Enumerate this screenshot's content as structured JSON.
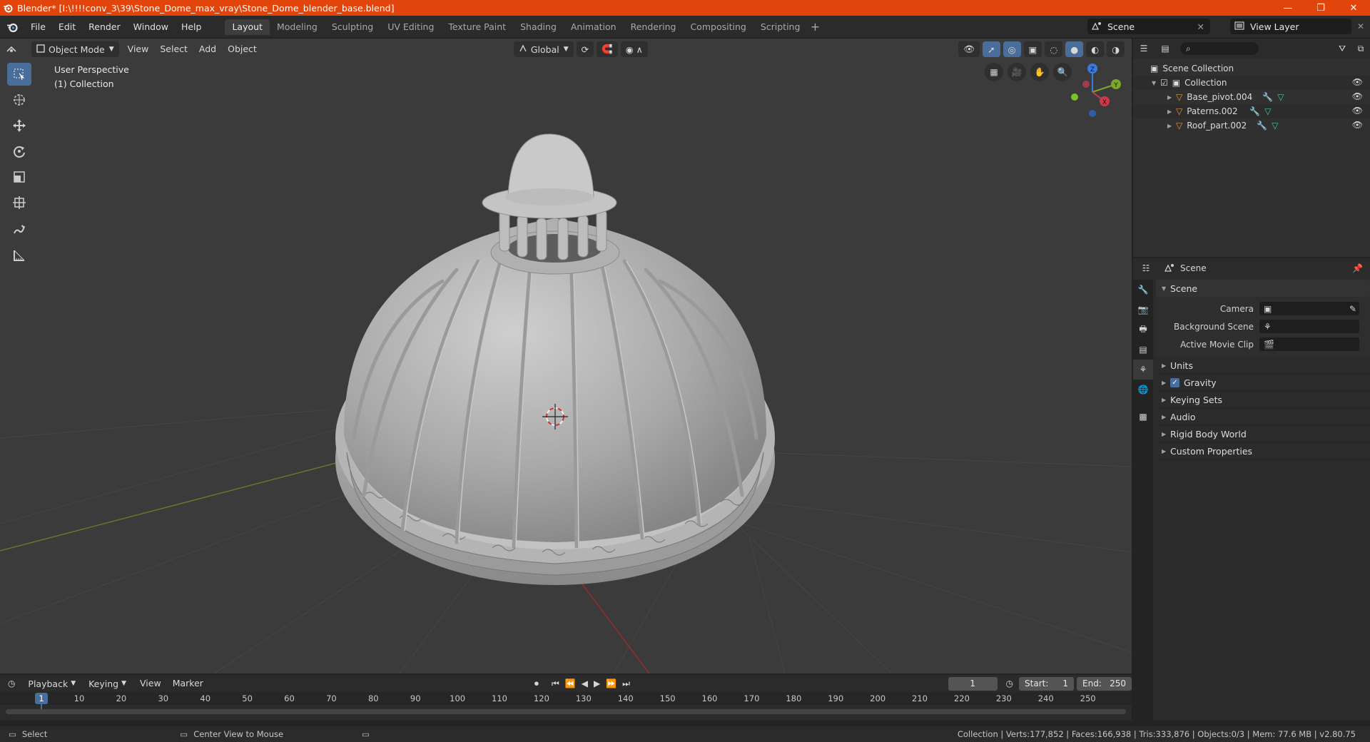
{
  "window": {
    "title": "Blender* [I:\\!!!!conv_3\\39\\Stone_Dome_max_vray\\Stone_Dome_blender_base.blend]",
    "minimize": "—",
    "maximize": "❐",
    "close": "✕"
  },
  "menu": {
    "items": [
      "File",
      "Edit",
      "Render",
      "Window",
      "Help"
    ],
    "workspaces": [
      "Layout",
      "Modeling",
      "Sculpting",
      "UV Editing",
      "Texture Paint",
      "Shading",
      "Animation",
      "Rendering",
      "Compositing",
      "Scripting"
    ],
    "active_workspace": "Layout",
    "add_tab": "+",
    "scene_name": "Scene",
    "view_layer": "View Layer"
  },
  "viewport": {
    "mode": "Object Mode",
    "menus": [
      "View",
      "Select",
      "Add",
      "Object"
    ],
    "transform_orientation": "Global",
    "overlay_line1": "User Perspective",
    "overlay_line2": "(1) Collection",
    "gizmo": {
      "x": "X",
      "y": "Y",
      "z": "Z"
    }
  },
  "outliner": {
    "search_placeholder": "",
    "root": "Scene Collection",
    "collection": "Collection",
    "objects": [
      "Base_pivot.004",
      "Paterns.002",
      "Roof_part.002"
    ]
  },
  "properties": {
    "header_title": "Scene",
    "panel_title": "Scene",
    "camera_label": "Camera",
    "background_scene_label": "Background Scene",
    "active_movie_clip_label": "Active Movie Clip",
    "subpanels": [
      "Units",
      "Gravity",
      "Keying Sets",
      "Audio",
      "Rigid Body World",
      "Custom Properties"
    ],
    "gravity_checked": true
  },
  "timeline": {
    "menus": [
      "Playback",
      "Keying",
      "View",
      "Marker"
    ],
    "current_frame": "1",
    "start_label": "Start:",
    "start_value": "1",
    "end_label": "End:",
    "end_value": "250",
    "ruler_ticks": [
      "1",
      "10",
      "20",
      "30",
      "40",
      "50",
      "60",
      "70",
      "80",
      "90",
      "100",
      "110",
      "120",
      "130",
      "140",
      "150",
      "160",
      "170",
      "180",
      "190",
      "200",
      "210",
      "220",
      "230",
      "240",
      "250"
    ]
  },
  "status": {
    "left_action": "Select",
    "mid_action": "Center View to Mouse",
    "stats": "Collection | Verts:177,852 | Faces:166,938 | Tris:333,876 | Objects:0/3 | Mem: 77.6 MB | v2.80.75"
  },
  "colors": {
    "accent_blue": "#4a6e9b",
    "titlebar": "#e2450b",
    "object_orange": "#e0953d",
    "modifier_blue": "#6fa0e0",
    "mesh_green": "#47c29b"
  }
}
